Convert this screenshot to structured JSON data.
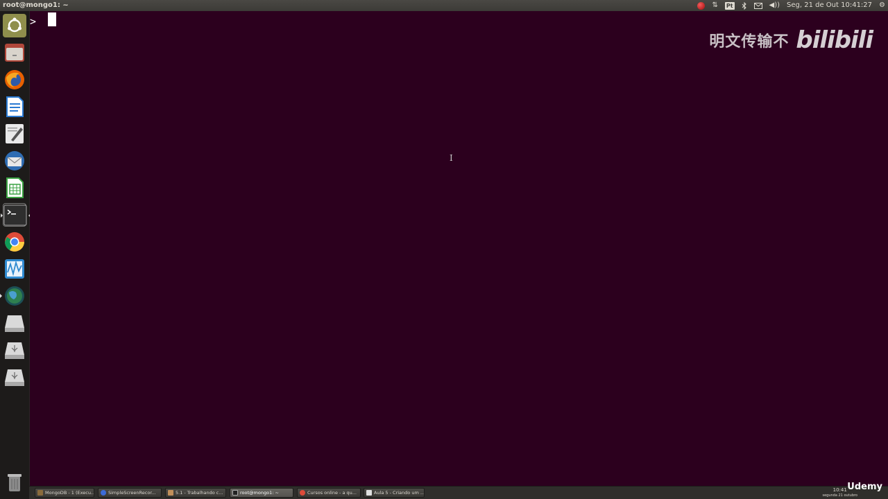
{
  "top_panel": {
    "window_title": "root@mongo1: ~",
    "keyboard_layout": "Pt",
    "clock": "Seg, 21 de Out 10:41:27",
    "icons": [
      "record-icon",
      "network-icon",
      "keyboard-layout-icon",
      "bluetooth-icon",
      "mail-icon",
      "volume-icon",
      "gear-icon"
    ]
  },
  "launcher": {
    "items": [
      {
        "name": "ubuntu-home-icon",
        "color": "#9a9a52"
      },
      {
        "name": "files-icon",
        "color": "#b84a3d"
      },
      {
        "name": "firefox-icon",
        "color": "#e86a1e"
      },
      {
        "name": "writer-icon",
        "color": "#2a7ad2"
      },
      {
        "name": "text-editor-icon",
        "color": "#d9d9d9"
      },
      {
        "name": "thunderbird-icon",
        "color": "#2f6db3"
      },
      {
        "name": "calc-icon",
        "color": "#3aa142"
      },
      {
        "name": "terminal-icon",
        "color": "#2e2e2e"
      },
      {
        "name": "chrome-icon",
        "color": "#dd4b39"
      },
      {
        "name": "system-monitor-icon",
        "color": "#2f8ad0"
      },
      {
        "name": "globe-icon",
        "color": "#3a8a8f"
      },
      {
        "name": "drive-icon",
        "color": "#bbbbbb"
      },
      {
        "name": "usb-drive-icon",
        "color": "#bbbbbb"
      },
      {
        "name": "usb-drive-2-icon",
        "color": "#bbbbbb"
      }
    ],
    "trash": "trash-icon"
  },
  "terminal": {
    "prompt": ">",
    "background": "#2c001e",
    "mouse_cursor": "I"
  },
  "watermark": {
    "text": "明文传输不",
    "logo": "bilibili"
  },
  "taskbar": {
    "tasks": [
      {
        "label": "MongoDB - 1 (Execu...",
        "active": false,
        "icon_color": "#8a6b3c"
      },
      {
        "label": "SimpleScreenRecor...",
        "active": false,
        "icon_color": "#3c6bd8"
      },
      {
        "label": "5.1 - Trabalhando c...",
        "active": false,
        "icon_color": "#c08f5a"
      },
      {
        "label": "root@mongo1: ~",
        "active": true,
        "icon_color": "#222222"
      },
      {
        "label": "Cursos online - a qu...",
        "active": false,
        "icon_color": "#dd4b39"
      },
      {
        "label": "Aula 5 - Criando um ...",
        "active": false,
        "icon_color": "#e0e0e0"
      }
    ],
    "clock_time": "10:41",
    "clock_date": "segunda 21 outubro"
  },
  "brand_overlay": "Udemy"
}
